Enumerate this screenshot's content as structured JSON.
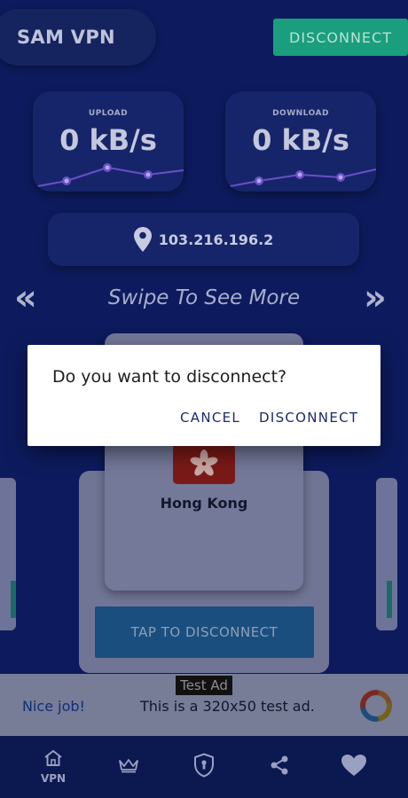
{
  "app": {
    "title": "SAM VPN"
  },
  "header": {
    "disconnect_label": "DISCONNECT"
  },
  "stats": {
    "upload": {
      "label": "UPLOAD",
      "value": "0 kB/s"
    },
    "download": {
      "label": "DOWNLOAD",
      "value": "0 kB/s"
    }
  },
  "connection": {
    "ip": "103.216.196.2",
    "icon": "location-pin-icon"
  },
  "carousel": {
    "hint": "Swipe To See More",
    "prev_icon": "double-chevron-left-icon",
    "next_icon": "double-chevron-right-icon",
    "server": {
      "country": "Hong Kong",
      "flag_icon": "hong-kong-flag-icon"
    },
    "tap_label": "TAP TO DISCONNECT"
  },
  "ad": {
    "label": "Test Ad",
    "headline": "Nice job!",
    "text": "This is a 320x50 test ad."
  },
  "nav": {
    "items": [
      {
        "label": "VPN",
        "icon": "home-icon"
      },
      {
        "label": "",
        "icon": "crown-icon"
      },
      {
        "label": "",
        "icon": "shield-icon"
      },
      {
        "label": "",
        "icon": "share-icon"
      },
      {
        "label": "",
        "icon": "heart-icon"
      }
    ]
  },
  "dialog": {
    "message": "Do you want to disconnect?",
    "cancel_label": "CANCEL",
    "confirm_label": "DISCONNECT"
  },
  "colors": {
    "background": "#0d1b5e",
    "accent_green": "#1a9e7d",
    "graph_line": "#6a4fc9",
    "dialog_button": "#1b2a6a"
  }
}
